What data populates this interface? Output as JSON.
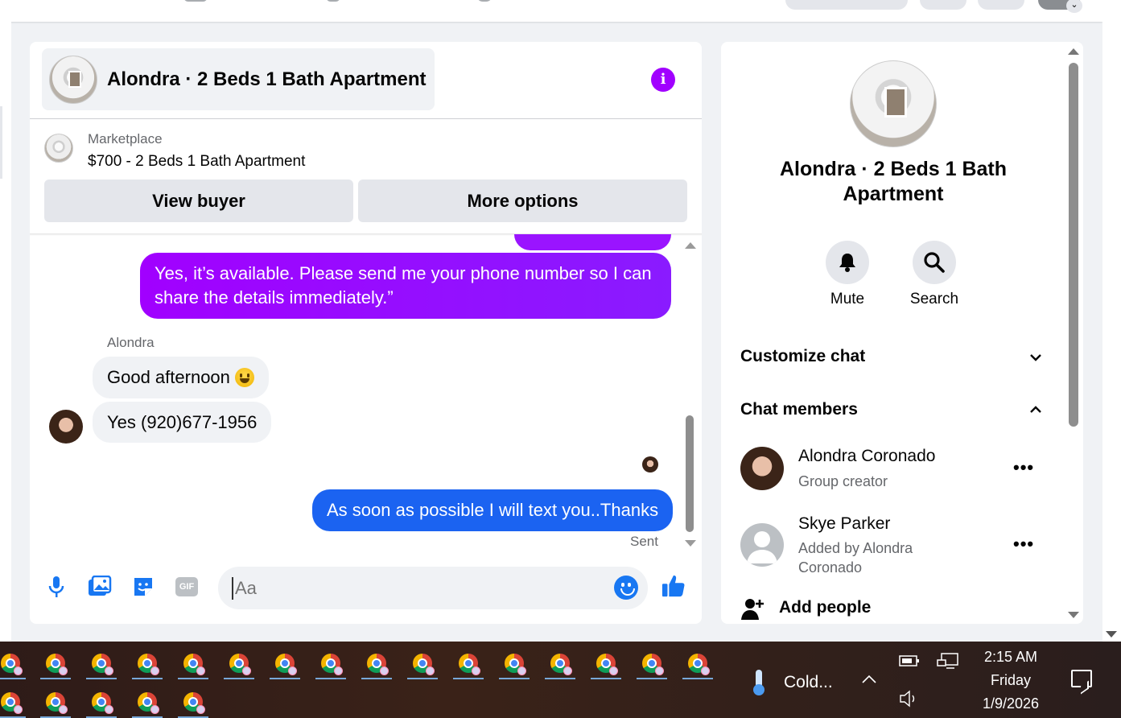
{
  "chat": {
    "title": "Alondra · 2 Beds 1 Bath Apartment",
    "marketplace_label": "Marketplace",
    "listing_title": "$700 - 2 Beds 1 Bath Apartment",
    "view_buyer_label": "View buyer",
    "more_options_label": "More options",
    "messages": [
      {
        "from": "me",
        "text": "Yes, it’s available. Please send me your phone number so I can share the details immediately.”"
      },
      {
        "from": "Alondra",
        "sender_label": "Alondra",
        "text": "Good afternoon"
      },
      {
        "from": "Alondra",
        "text": "Yes (920)677-1956"
      },
      {
        "from": "me",
        "text": "As soon as possible I will text you..Thanks",
        "status": "Sent"
      }
    ],
    "composer_placeholder": "Aa",
    "colors": {
      "sent_gradient": "#a100ff",
      "sent_blue": "#1b63f1",
      "accent": "#1877f2"
    }
  },
  "panel": {
    "title": "Alondra · 2 Beds 1 Bath Apartment",
    "mute_label": "Mute",
    "search_label": "Search",
    "customize_label": "Customize chat",
    "members_label": "Chat members",
    "members": [
      {
        "name": "Alondra Coronado",
        "role": "Group creator"
      },
      {
        "name": "Skye Parker",
        "role": "Added by Alondra Coronado"
      }
    ],
    "add_people_label": "Add people"
  },
  "taskbar": {
    "weather_text": "Cold...",
    "time": "2:15 AM",
    "day": "Friday",
    "date": "1/9/2026",
    "app_icon": "chrome-icon"
  }
}
